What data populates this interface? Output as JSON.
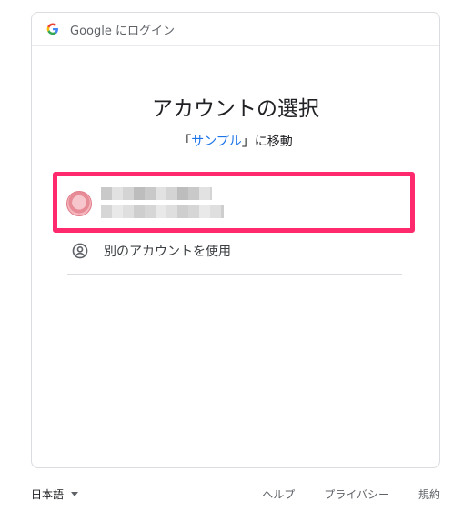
{
  "header": {
    "text": "Google にログイン"
  },
  "main": {
    "title": "アカウントの選択",
    "subtitle_prefix": "「",
    "app_name": "サンプル",
    "subtitle_suffix": "」に移動",
    "other_account_label": "別のアカウントを使用"
  },
  "footer": {
    "language": "日本語",
    "links": [
      "ヘルプ",
      "プライバシー",
      "規約"
    ]
  },
  "colors": {
    "accent": "#1a73e8",
    "highlight": "#ff2a6d"
  }
}
